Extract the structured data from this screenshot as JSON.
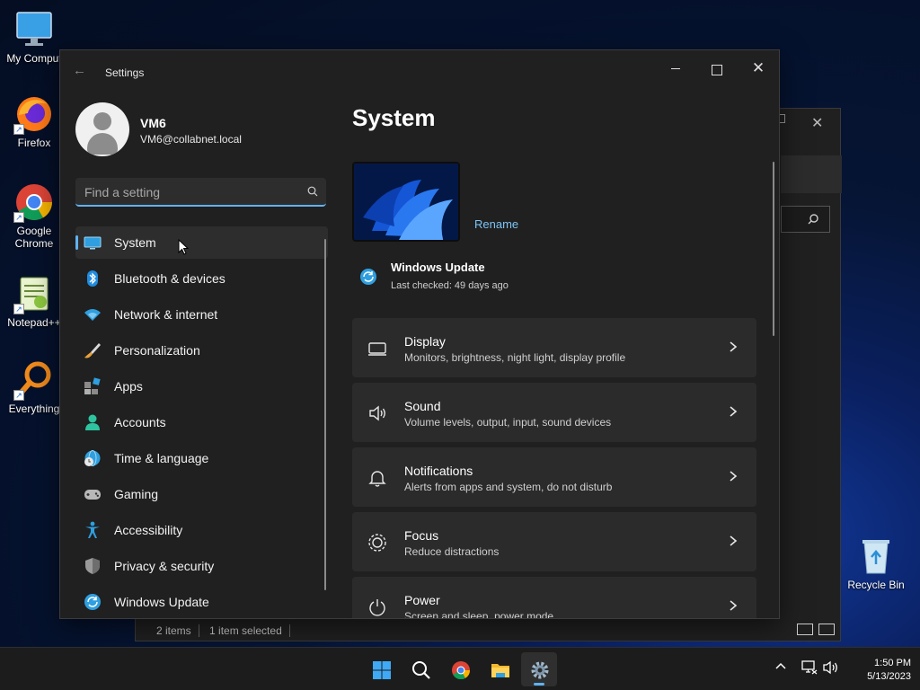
{
  "desktop": {
    "icons": [
      {
        "label": "My Comput",
        "icon": "monitor-icon"
      },
      {
        "label": "Firefox",
        "icon": "firefox-icon"
      },
      {
        "label": "Google Chrome",
        "icon": "chrome-icon"
      },
      {
        "label": "Notepad++",
        "icon": "notepad-plus-plus-icon"
      },
      {
        "label": "Everything",
        "icon": "everything-search-icon"
      },
      {
        "label": "Recycle Bin",
        "icon": "recycle-bin-icon"
      }
    ]
  },
  "background_window": {
    "status": {
      "items_count": "2 items",
      "selected": "1 item selected"
    }
  },
  "settings": {
    "title": "Settings",
    "user": {
      "name": "VM6",
      "email": "VM6@collabnet.local"
    },
    "search_placeholder": "Find a setting",
    "nav": [
      {
        "label": "System",
        "icon": "system-icon",
        "selected": true
      },
      {
        "label": "Bluetooth & devices",
        "icon": "bluetooth-icon"
      },
      {
        "label": "Network & internet",
        "icon": "wifi-icon"
      },
      {
        "label": "Personalization",
        "icon": "brush-icon"
      },
      {
        "label": "Apps",
        "icon": "apps-icon"
      },
      {
        "label": "Accounts",
        "icon": "accounts-icon"
      },
      {
        "label": "Time & language",
        "icon": "globe-clock-icon"
      },
      {
        "label": "Gaming",
        "icon": "gamepad-icon"
      },
      {
        "label": "Accessibility",
        "icon": "accessibility-icon"
      },
      {
        "label": "Privacy & security",
        "icon": "shield-icon"
      },
      {
        "label": "Windows Update",
        "icon": "update-icon"
      }
    ],
    "main": {
      "heading": "System",
      "rename_label": "Rename",
      "windows_update": {
        "title": "Windows Update",
        "subtitle": "Last checked: 49 days ago"
      },
      "cards": [
        {
          "title": "Display",
          "subtitle": "Monitors, brightness, night light, display profile",
          "icon": "display-icon"
        },
        {
          "title": "Sound",
          "subtitle": "Volume levels, output, input, sound devices",
          "icon": "speaker-icon"
        },
        {
          "title": "Notifications",
          "subtitle": "Alerts from apps and system, do not disturb",
          "icon": "bell-icon"
        },
        {
          "title": "Focus",
          "subtitle": "Reduce distractions",
          "icon": "focus-icon"
        },
        {
          "title": "Power",
          "subtitle": "Screen and sleep, power mode",
          "icon": "power-icon"
        }
      ]
    }
  },
  "taskbar": {
    "apps": [
      "start-icon",
      "search-icon",
      "chrome-icon",
      "file-explorer-icon",
      "settings-icon"
    ],
    "time": "1:50 PM",
    "date": "5/13/2023"
  },
  "colors": {
    "accent": "#5fb2f2",
    "link": "#7cc4f5",
    "window_bg": "#202020",
    "card_bg": "#2b2b2b"
  }
}
